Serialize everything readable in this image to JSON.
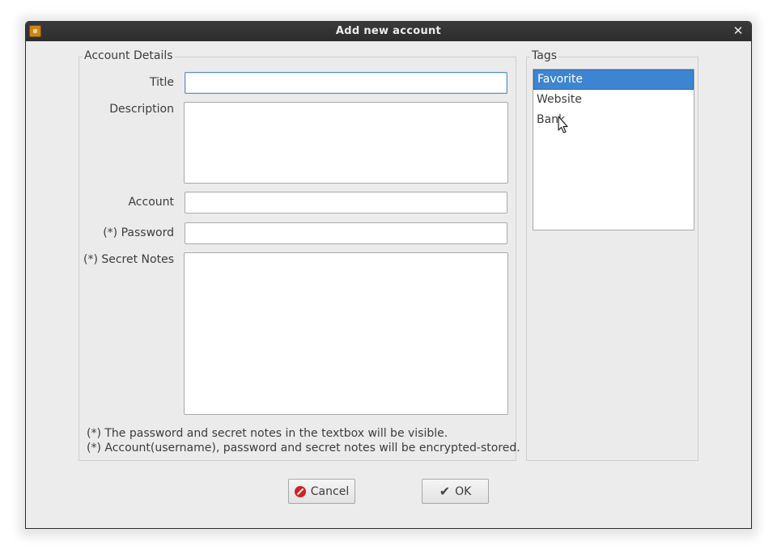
{
  "window": {
    "title": "Add new account",
    "app_icon": "app-icon",
    "close_glyph": "✕"
  },
  "account_details": {
    "group_title": "Account Details",
    "title_label": "Title",
    "title_value": "",
    "description_label": "Description",
    "description_value": "",
    "account_label": "Account",
    "account_value": "",
    "password_label": "(*) Password",
    "password_value": "",
    "secret_notes_label": "(*) Secret Notes",
    "secret_notes_value": "",
    "note_1": "(*) The password and secret notes in the textbox will be visible.",
    "note_2": "(*) Account(username), password and secret notes will be encrypted-stored."
  },
  "tags": {
    "group_title": "Tags",
    "items": [
      {
        "label": "Favorite",
        "selected": true
      },
      {
        "label": "Website",
        "selected": false
      },
      {
        "label": "Bank",
        "selected": false
      }
    ]
  },
  "buttons": {
    "cancel_label": "Cancel",
    "ok_label": "OK"
  },
  "colors": {
    "selection": "#3d85d0",
    "titlebar": "#2d2d2d",
    "cancel_icon": "#d32020"
  }
}
